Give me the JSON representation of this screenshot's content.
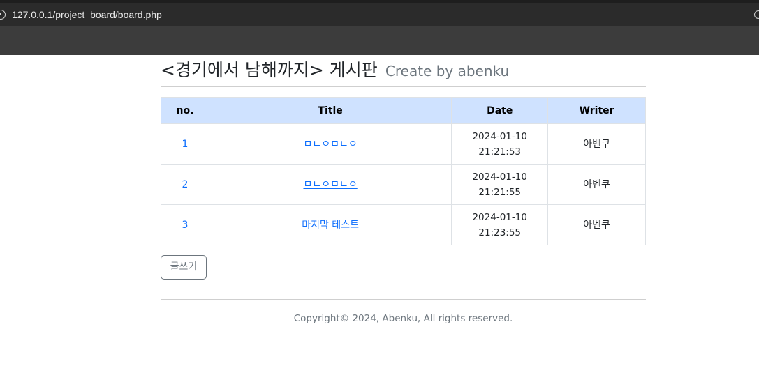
{
  "browser": {
    "url": "127.0.0.1/project_board/board.php"
  },
  "header": {
    "title": "<경기에서 남해까지> 게시판",
    "subtitle": "Create by abenku"
  },
  "table": {
    "columns": [
      "no.",
      "Title",
      "Date",
      "Writer"
    ],
    "rows": [
      {
        "no": "1",
        "title": "ㅁㄴㅇㅁㄴㅇ",
        "date": "2024-01-10 21:21:53",
        "writer": "아벤쿠"
      },
      {
        "no": "2",
        "title": "ㅁㄴㅇㅁㄴㅇ",
        "date": "2024-01-10 21:21:55",
        "writer": "아벤쿠"
      },
      {
        "no": "3",
        "title": "마지막 테스트",
        "date": "2024-01-10 21:23:55",
        "writer": "아벤쿠"
      }
    ]
  },
  "actions": {
    "write_label": "글쓰기"
  },
  "footer": {
    "copyright": "Copyright© 2024, Abenku, All rights reserved."
  },
  "colors": {
    "header_row_bg": "#cfe2ff",
    "link": "#0d6efd",
    "muted": "#6c757d"
  }
}
